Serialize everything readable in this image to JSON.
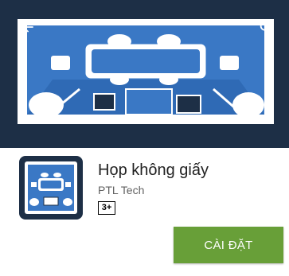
{
  "app": {
    "title": "Họp không giấy",
    "developer": "PTL Tech",
    "content_rating": "3+"
  },
  "actions": {
    "install_label": "CÀI ĐẶT"
  },
  "icons": {
    "back": "arrow-back-icon",
    "search": "search-icon"
  },
  "colors": {
    "banner_bg": "#1d2f46",
    "banner_blue": "#3a78c5",
    "install_green": "#689f38"
  }
}
